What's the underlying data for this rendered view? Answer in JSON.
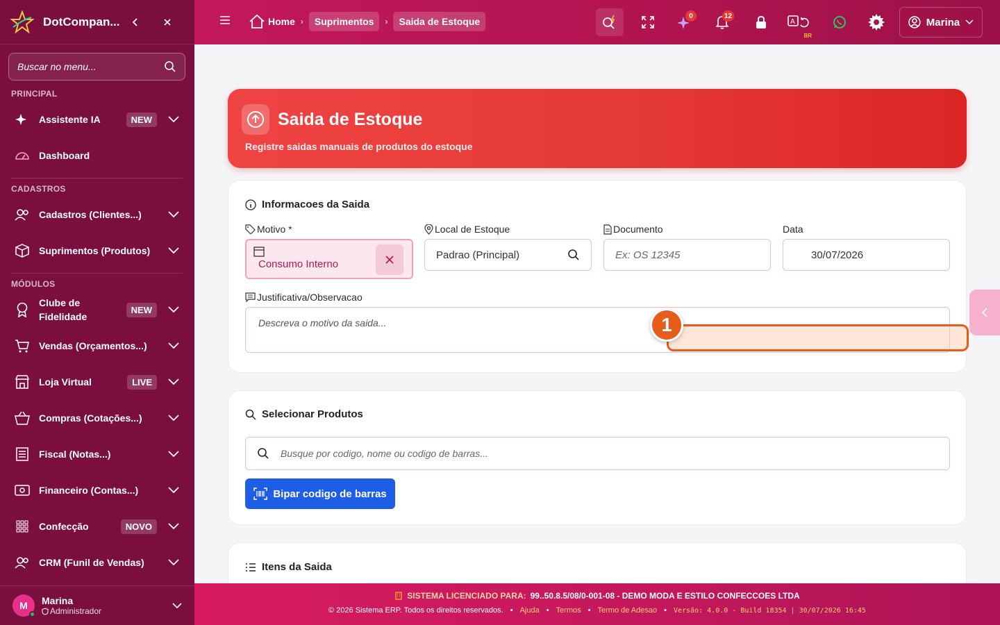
{
  "sidebar": {
    "brand": "DotCompan...",
    "search_placeholder": "Buscar no menu...",
    "sections": {
      "principal": "PRINCIPAL",
      "cadastros": "CADASTROS",
      "modulos": "MÓDULOS"
    },
    "items": [
      {
        "label": "Assistente IA",
        "badge": "NEW"
      },
      {
        "label": "Dashboard"
      },
      {
        "label": "Cadastros (Clientes...)"
      },
      {
        "label": "Suprimentos (Produtos)"
      },
      {
        "label": "Clube de Fidelidade",
        "badge": "NEW"
      },
      {
        "label": "Vendas (Orçamentos...)"
      },
      {
        "label": "Loja Virtual",
        "badge": "LIVE"
      },
      {
        "label": "Compras (Cotações...)"
      },
      {
        "label": "Fiscal (Notas...)"
      },
      {
        "label": "Financeiro (Contas...)"
      },
      {
        "label": "Confecção",
        "badge": "NOVO"
      },
      {
        "label": "CRM (Funil de Vendas)"
      }
    ],
    "user": {
      "initial": "M",
      "name": "Marina",
      "role": "Administrador"
    }
  },
  "topbar": {
    "breadcrumb": [
      "Home",
      "Suprimentos",
      "Saida de Estoque"
    ],
    "badges": {
      "ai": "0",
      "notifications": "12"
    },
    "lang_badge": "BR",
    "user": "Marina"
  },
  "hero": {
    "title": "Saida de Estoque",
    "subtitle": "Registre saidas manuais de produtos do estoque"
  },
  "info_card": {
    "title": "Informacoes da Saida",
    "motivo_label": "Motivo *",
    "motivo_value": "Consumo Interno",
    "local_label": "Local de Estoque",
    "local_value": "Padrao (Principal)",
    "documento_label": "Documento",
    "documento_placeholder": "Ex: OS 12345",
    "data_label": "Data",
    "data_value": "30/07/2026",
    "justificativa_label": "Justificativa/Observacao",
    "justificativa_placeholder": "Descreva o motivo da saida..."
  },
  "products_card": {
    "title": "Selecionar Produtos",
    "search_placeholder": "Busque por codigo, nome ou codigo de barras...",
    "barcode_button": "Bipar codigo de barras"
  },
  "items_card": {
    "title": "Itens da Saida"
  },
  "callout": {
    "number": "1"
  },
  "footer": {
    "license_label": "SISTEMA LICENCIADO PARA:",
    "license_value": "99..50.8.5/08/0-001-08 - DEMO MODA E ESTILO CONFECCOES LTDA",
    "copyright": "© 2026 Sistema ERP. Todos os direitos reservados.",
    "links": [
      "Ajuda",
      "Termos",
      "Termo de Adesao"
    ],
    "version": "Versão: 4.0.0 - Build 18354 | 30/07/2026 16:45"
  },
  "colors": {
    "sidebar": "#7a0f3f",
    "topbar": "#c2185b",
    "hero": "#e53935",
    "primary_button": "#1e5ee6",
    "callout": "#e65c1a"
  }
}
